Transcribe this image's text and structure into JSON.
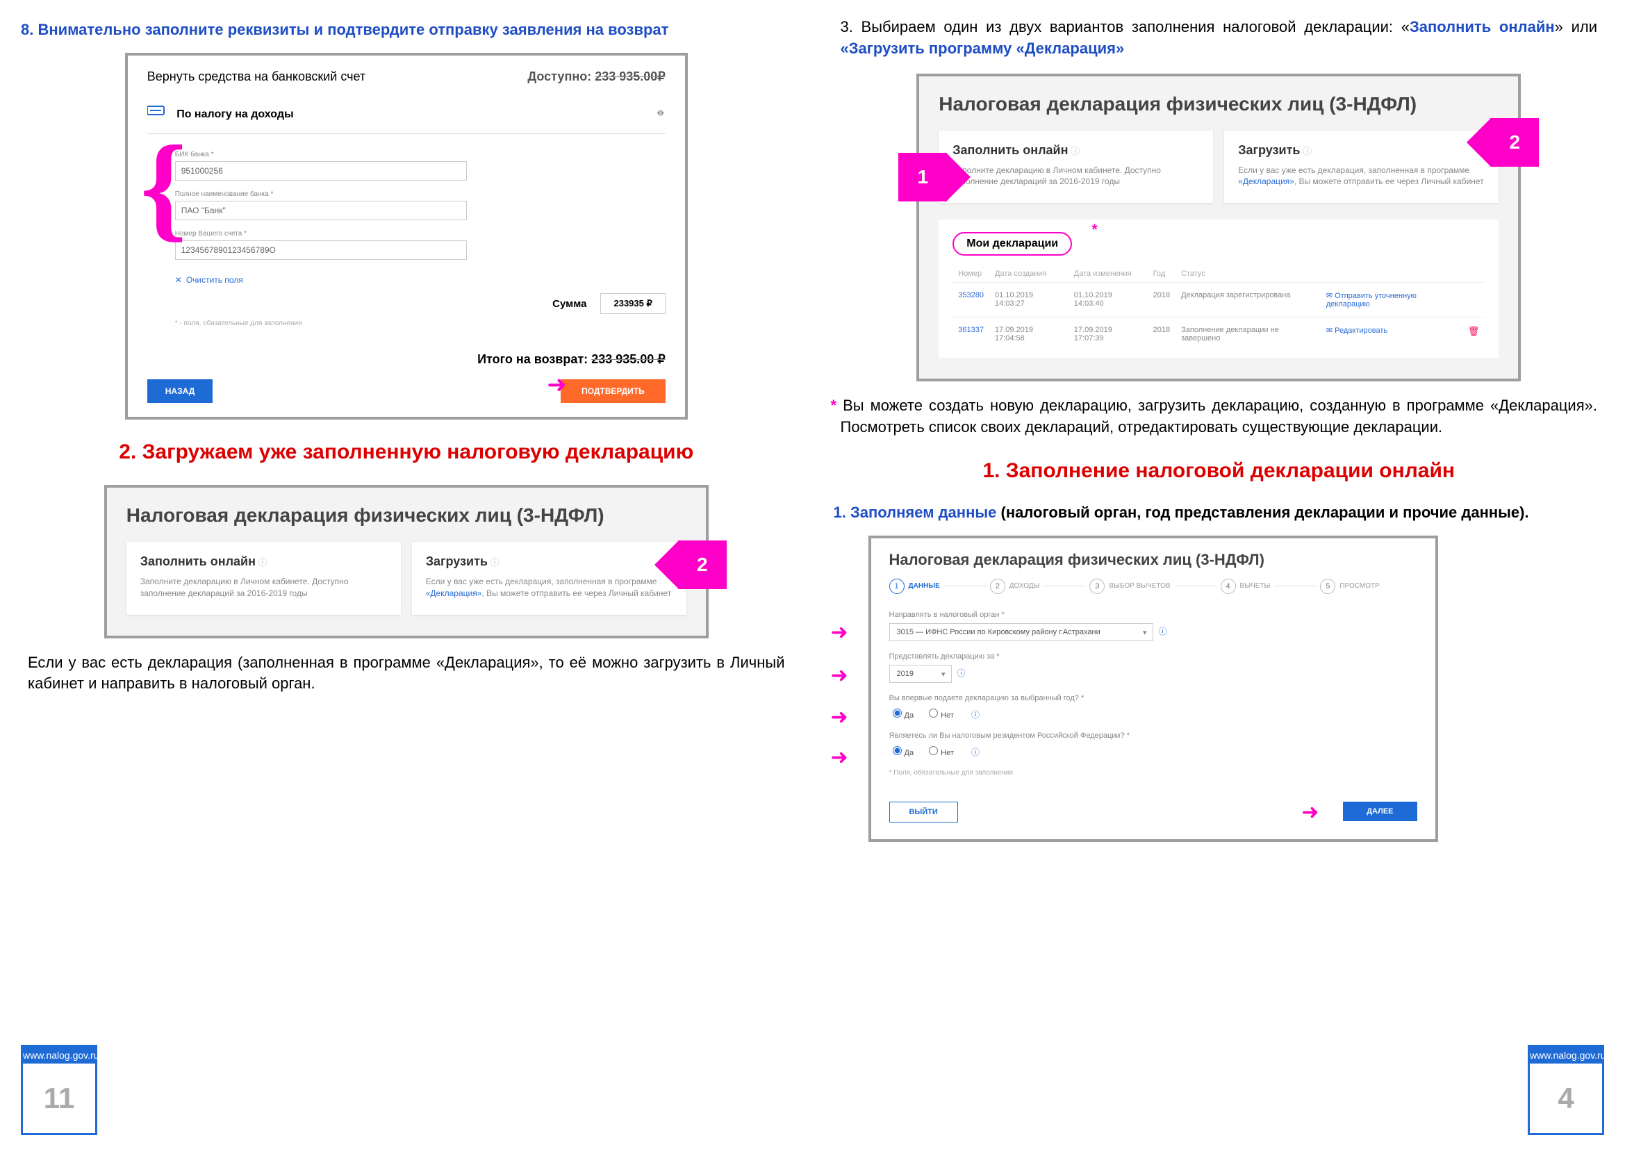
{
  "left": {
    "step8_title": "8. Внимательно заполните реквизиты и подтвердите отправку заявления на возврат",
    "p1": {
      "return_title": "Вернуть средства на банковский счет",
      "available_label": "Доступно:",
      "available_value": "233 935.00₽",
      "tax_label": "По налогу на доходы",
      "bik_label": "БИК банка *",
      "bik_value": "951000256",
      "bank_label": "Полное наименование банка *",
      "bank_value": "ПАО \"Банк\"",
      "acct_label": "Номер Вашего счета *",
      "acct_value": "1234567890123456789О",
      "clear": "Очистить поля",
      "req_note": "* - поля, обязательные для заполнения",
      "sum_label": "Сумма",
      "sum_value": "233935 ₽",
      "total_label": "Итого на возврат:",
      "total_value": "233 935.00 ₽",
      "back": "НАЗАД",
      "confirm": "ПОДТВЕРДИТЬ"
    },
    "red_title_2": "2. Загружаем уже заполненную налоговую декларацию",
    "decl": {
      "title": "Налоговая декларация физических лиц (3-НДФЛ)",
      "card1_title": "Заполнить онлайн",
      "card1_text": "Заполните декларацию в Личном кабинете. Доступно заполнение деклараций за 2016-2019 годы",
      "card2_title": "Загрузить",
      "card2_text_a": "Если у вас уже есть декларация, заполненная в программе ",
      "card2_text_link": "«Декларация»",
      "card2_text_b": ", Вы можете отправить ее через Личный кабинет"
    },
    "marker2": "2",
    "para_after": "Если у вас есть декларация (заполненная в программе «Декларация», то её можно загрузить в Личный кабинет и направить в налоговый орган.",
    "badge_site": "www.nalog.gov.ru",
    "badge_num": "11"
  },
  "right": {
    "step3_text_a": "3. Выбираем один из двух вариантов заполнения налоговой декларации: «",
    "step3_link1": "Заполнить онлайн",
    "step3_mid": "» или ",
    "step3_link2": "«Загрузить программу «Декларация»",
    "marker1": "1",
    "marker2": "2",
    "mydecl": "Мои декларации",
    "tbl_hdr": {
      "num": "Номер",
      "created": "Дата создания",
      "changed": "Дата изменения",
      "year": "Год",
      "status": "Статус"
    },
    "rows": [
      {
        "num": "353280",
        "created": "01.10.2019 14:03:27",
        "changed": "01.10.2019 14:03:40",
        "year": "2018",
        "status": "Декларация зарегистрирована",
        "action": "Отправить уточненную декларацию",
        "trash": ""
      },
      {
        "num": "361337",
        "created": "17.09.2019 17:04:58",
        "changed": "17.09.2019 17:07:39",
        "year": "2018",
        "status": "Заполнение декларации не завершено",
        "action": "Редактировать",
        "trash": "🗑"
      }
    ],
    "note_star": "*",
    "note_para": "Вы можете создать новую декларацию, загрузить декларацию, созданную в программе «Декларация». Посмотреть список своих деклараций, отредактировать существующие декларации.",
    "red_title_1": "1. Заполнение налоговой декларации онлайн",
    "sub_blue": "1. Заполняем данные",
    "sub_black": " (налоговый орган, год представления декларации и прочие данные).",
    "wiz": {
      "title": "Налоговая декларация физических лиц (3-НДФЛ)",
      "steps": [
        "ДАННЫЕ",
        "ДОХОДЫ",
        "ВЫБОР ВЫЧЕТОВ",
        "ВЫЧЕТЫ",
        "ПРОСМОТР"
      ],
      "l1": "Направлять в налоговый орган *",
      "v1": "3015 — ИФНС России по Кировскому району г.Астрахани",
      "l2": "Представлять декларацию за *",
      "v2": "2019",
      "l3": "Вы впервые подаете декларацию за выбранный год? *",
      "yes": "Да",
      "no": "Нет",
      "l4": "Являетесь ли Вы налоговым резидентом Российской Федерации? *",
      "req": "* Поля, обязательные для заполнения",
      "exit": "ВЫЙТИ",
      "next": "ДАЛЕЕ"
    },
    "badge_site": "www.nalog.gov.ru",
    "badge_num": "4"
  }
}
